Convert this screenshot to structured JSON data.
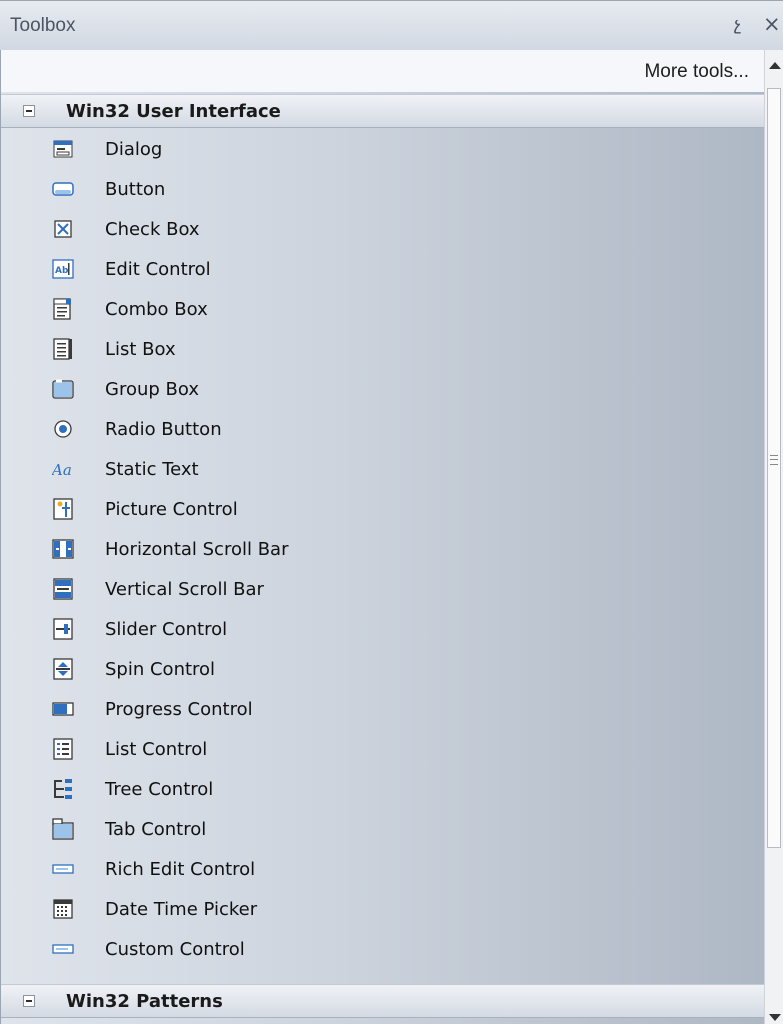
{
  "window": {
    "title": "Toolbox",
    "pin_glyph": "չ",
    "close_glyph": "×"
  },
  "more_tools_label": "More tools...",
  "sections": [
    {
      "label": "Win32 User Interface",
      "expanded": true
    },
    {
      "label": "Win32 Patterns",
      "expanded": true
    }
  ],
  "items": [
    {
      "label": "Dialog",
      "icon": "dialog-icon"
    },
    {
      "label": "Button",
      "icon": "button-icon"
    },
    {
      "label": "Check Box",
      "icon": "checkbox-icon"
    },
    {
      "label": "Edit Control",
      "icon": "edit-control-icon"
    },
    {
      "label": "Combo Box",
      "icon": "combo-box-icon"
    },
    {
      "label": "List Box",
      "icon": "list-box-icon"
    },
    {
      "label": "Group Box",
      "icon": "group-box-icon"
    },
    {
      "label": "Radio Button",
      "icon": "radio-button-icon"
    },
    {
      "label": "Static Text",
      "icon": "static-text-icon"
    },
    {
      "label": "Picture Control",
      "icon": "picture-icon"
    },
    {
      "label": "Horizontal Scroll Bar",
      "icon": "horizontal-scroll-icon"
    },
    {
      "label": "Vertical Scroll Bar",
      "icon": "vertical-scroll-icon"
    },
    {
      "label": "Slider Control",
      "icon": "slider-icon"
    },
    {
      "label": "Spin Control",
      "icon": "spin-icon"
    },
    {
      "label": "Progress Control",
      "icon": "progress-icon"
    },
    {
      "label": "List Control",
      "icon": "list-control-icon"
    },
    {
      "label": "Tree Control",
      "icon": "tree-icon"
    },
    {
      "label": "Tab Control",
      "icon": "tab-icon"
    },
    {
      "label": "Rich Edit Control",
      "icon": "rich-edit-icon"
    },
    {
      "label": "Date Time Picker",
      "icon": "date-time-picker-icon"
    },
    {
      "label": "Custom Control",
      "icon": "custom-control-icon"
    }
  ],
  "colors": {
    "accent_blue": "#2f6fbf",
    "panel": "#ccd3dd"
  }
}
